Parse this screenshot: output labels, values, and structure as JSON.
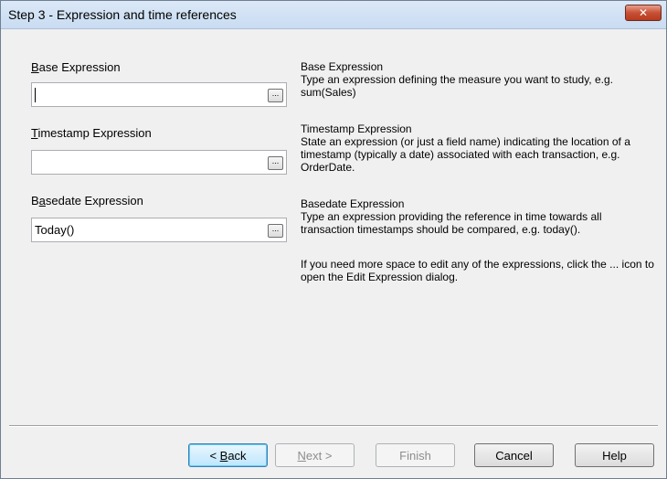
{
  "window": {
    "title": "Step 3 - Expression and time references"
  },
  "fields": {
    "base": {
      "label_access": "B",
      "label_rest": "ase Expression",
      "value": ""
    },
    "timestamp": {
      "label_access": "T",
      "label_rest": "imestamp Expression",
      "value": ""
    },
    "basedate": {
      "label_prefix": "B",
      "label_access": "a",
      "label_rest": "sedate Expression",
      "value": "Today()"
    },
    "browse_label": "..."
  },
  "help": {
    "base_title": "Base Expression",
    "base_text": "Type an expression defining the measure you want to study, e.g. sum(Sales)",
    "timestamp_title": "Timestamp Expression",
    "timestamp_text": "State an expression (or just a field name) indicating the location of a timestamp (typically a date) associated with each transaction, e.g. OrderDate.",
    "basedate_title": "Basedate Expression",
    "basedate_text": "Type an expression providing the reference in time towards all transaction timestamps should be compared, e.g. today().",
    "more_space_text": "If you need more space to edit any of the expressions, click the ... icon to open the Edit Expression dialog."
  },
  "buttons": {
    "back_prefix": "< ",
    "back_access": "B",
    "back_rest": "ack",
    "next_access": "N",
    "next_rest": "ext >",
    "finish": "Finish",
    "cancel": "Cancel",
    "help": "Help"
  },
  "colors": {
    "dialog_bg": "#f0f0f0",
    "close_button": "#c75035",
    "default_button_border": "#3c7fb1"
  }
}
